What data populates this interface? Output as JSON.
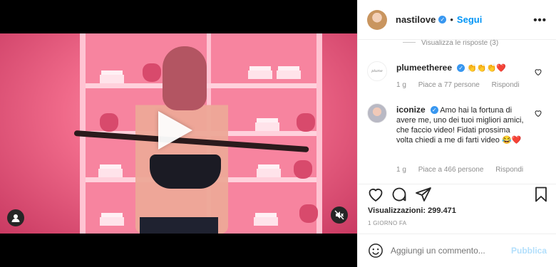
{
  "post": {
    "username": "nastilove",
    "follow_label": "Segui",
    "separator": "•",
    "more_label": "•••"
  },
  "comments": {
    "replies_link": "Visualizza le risposte (3)",
    "items": [
      {
        "username": "plumeetheree",
        "text": "👏👏👏❤️",
        "age": "1 g",
        "likes": "Piace a 77 persone",
        "reply_label": "Rispondi"
      },
      {
        "username": "iconize",
        "text": "Amo hai la fortuna di avere me, uno dei tuoi migliori amici, che faccio video! Fidati prossima volta chiedi a me di farti video 😂❤️",
        "age": "1 g",
        "likes": "Piace a 466 persone",
        "reply_label": "Rispondi"
      }
    ]
  },
  "stats": {
    "views_label": "Visualizzazioni:",
    "views_count": "299.471",
    "time_ago": "1 GIORNO FA"
  },
  "composer": {
    "placeholder": "Aggiungi un commento...",
    "post_label": "Pubblica"
  },
  "icons": {
    "play": "play-icon",
    "user_tag": "user-tag-icon",
    "mute": "mute-icon",
    "like": "heart-icon",
    "comment": "comment-icon",
    "share": "share-icon",
    "save": "bookmark-icon",
    "emoji": "emoji-icon",
    "more": "more-icon"
  },
  "colors": {
    "link_blue": "#0095f6",
    "verified_blue": "#3897f0",
    "muted_text": "#8e8e8e",
    "post_disabled": "#b2dffc"
  }
}
